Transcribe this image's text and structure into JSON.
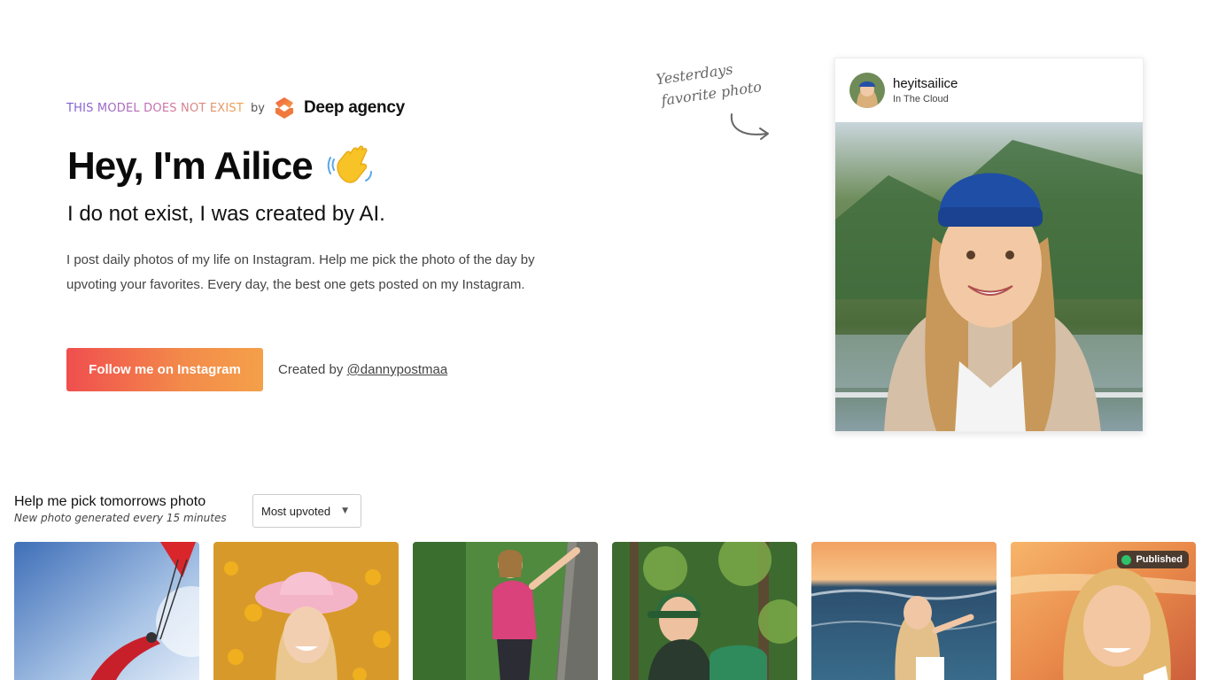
{
  "hero": {
    "tagline": "THIS MODEL DOES NOT EXIST",
    "by": "by",
    "brand": "Deep agency",
    "title": "Hey, I'm Ailice",
    "subtitle": "I do not exist, I was created by AI.",
    "intro": "I post daily photos of my life on Instagram. Help me pick the photo of the day by upvoting your favorites. Every day, the best one gets posted on my Instagram.",
    "cta_label": "Follow me on Instagram",
    "created_by": "Created by",
    "creator_handle": "@dannypostmaa"
  },
  "annotation": {
    "line1": "Yesterdays",
    "line2": "favorite photo"
  },
  "instagram_card": {
    "username": "heyitsailice",
    "location": "In The Cloud"
  },
  "pick": {
    "title": "Help me pick tomorrows photo",
    "subtitle": "New photo generated every 15 minutes",
    "sort_selected": "Most upvoted",
    "published_label": "Published"
  },
  "colors": {
    "cta_gradient_start": "#f04e4e",
    "cta_gradient_end": "#f4a049",
    "published_dot": "#2fc26b"
  }
}
